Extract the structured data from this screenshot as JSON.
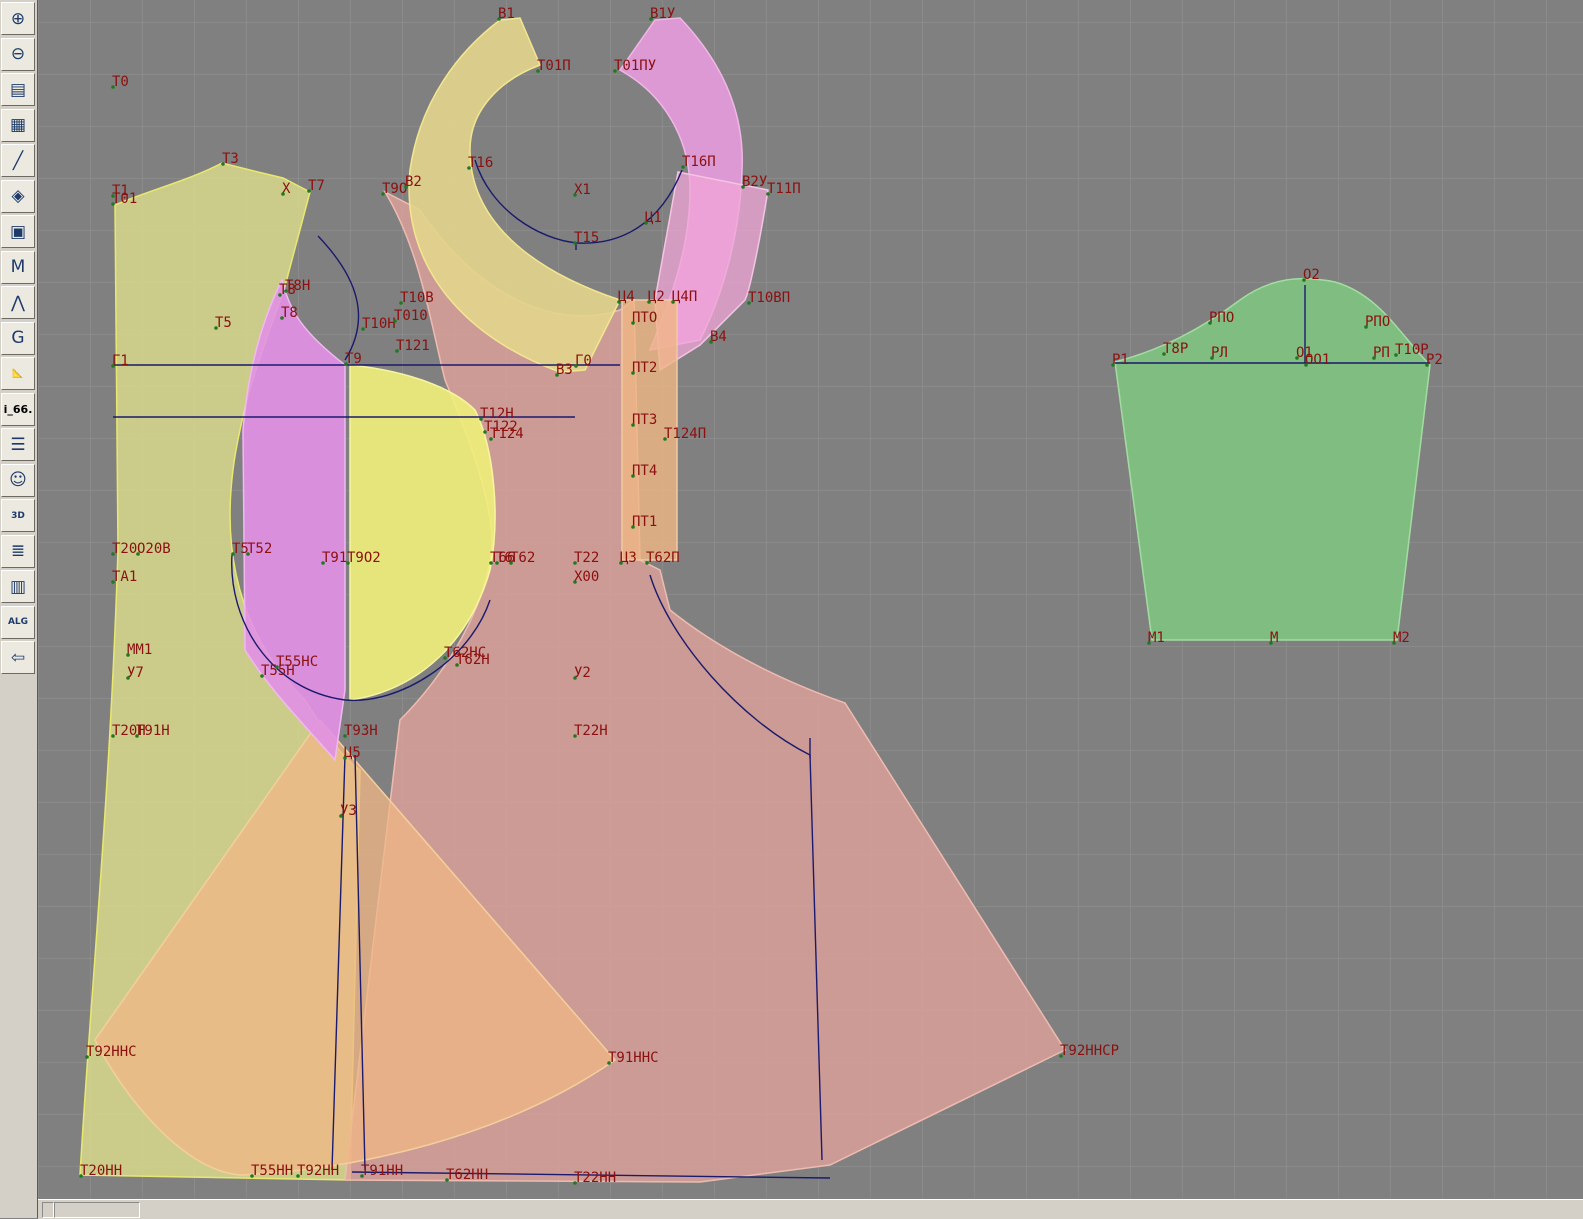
{
  "app": {
    "toolbar_label": "i_66."
  },
  "toolbar": [
    {
      "name": "zoom-in-icon",
      "glyph": "⊕"
    },
    {
      "name": "zoom-out-icon",
      "glyph": "⊖"
    },
    {
      "name": "pattern-sheet-icon",
      "glyph": "▤"
    },
    {
      "name": "grid-icon",
      "glyph": "▦"
    },
    {
      "name": "line-tool-icon",
      "glyph": "╱"
    },
    {
      "name": "layer-icon",
      "glyph": "◈"
    },
    {
      "name": "document-icon",
      "glyph": "▣"
    },
    {
      "name": "measure-m-icon",
      "glyph": "M"
    },
    {
      "name": "compass-icon",
      "glyph": "⋀"
    },
    {
      "name": "algorithm-g-icon",
      "glyph": "G"
    },
    {
      "name": "ruler-icon",
      "glyph": "📐"
    },
    {
      "name": "file-label",
      "text": "i_66."
    },
    {
      "name": "list-icon",
      "glyph": "☰"
    },
    {
      "name": "model-portrait-icon",
      "glyph": "☺"
    },
    {
      "name": "view-3d-icon",
      "glyph": "3D"
    },
    {
      "name": "table-icon",
      "glyph": "≣"
    },
    {
      "name": "library-icon",
      "glyph": "▥"
    },
    {
      "name": "alg-icon",
      "glyph": "ALG"
    },
    {
      "name": "exit-icon",
      "glyph": "⇦"
    }
  ],
  "colors": {
    "background": "#808080",
    "grid": "#8e8e8e",
    "front_panel": "#d9d98c",
    "back_panel": "#e0a19a",
    "collar_left": "#e3cf8c",
    "collar_right": "#e59bdb",
    "side_insert": "#e290e6",
    "yellow_insert": "#f0ef7a",
    "sleeve": "#7fc07f",
    "construction_line": "#1a1a6e",
    "point_label": "#8b1010"
  },
  "points": [
    "Т0",
    "В1",
    "В1У",
    "Т01П",
    "Т01ПУ",
    "Т3",
    "Т1",
    "Т01",
    "Х",
    "Т7",
    "Т16",
    "Т9О",
    "В2",
    "Х1",
    "Т16П",
    "В2У",
    "Т11П",
    "Ц1",
    "Т15",
    "Т8Н",
    "Т8",
    "Т5",
    "Т8",
    "Т10Н",
    "Т10В",
    "Т010",
    "Т121",
    "Ц4",
    "Ц2",
    "Ц4П",
    "Т10ВП",
    "ПТО",
    "В4",
    "Г1",
    "Т9",
    "В3",
    "Г0",
    "ПТ2",
    "Т12Н",
    "Т122",
    "Т124",
    "Т124П",
    "ПТ3",
    "ПТ4",
    "ПТ1",
    "Т20",
    "О20В",
    "Т5",
    "Т52",
    "Т91",
    "Т9О2",
    "Т66",
    "Т6",
    "Т62",
    "Т22",
    "Ц3",
    "Т62П",
    "ТА1",
    "Х00",
    "ММ1",
    "У7",
    "Т55НС",
    "Т62НС",
    "Т62Н",
    "Т55Н",
    "У2",
    "Т22Н",
    "Т20Н",
    "Т91Н",
    "Т93Н",
    "Ц5",
    "У3",
    "Т92ННС",
    "Т91ННС",
    "Т92ННСР",
    "Т20НН",
    "Т55НН",
    "Т92НН",
    "Т91НН",
    "Т62НН",
    "Т22НН",
    "О2",
    "РПО",
    "РПО",
    "Р1",
    "Т8Р",
    "РЛ",
    "О1",
    "ОО1",
    "РП",
    "Т10Р",
    "Р2",
    "М1",
    "М",
    "М2"
  ]
}
